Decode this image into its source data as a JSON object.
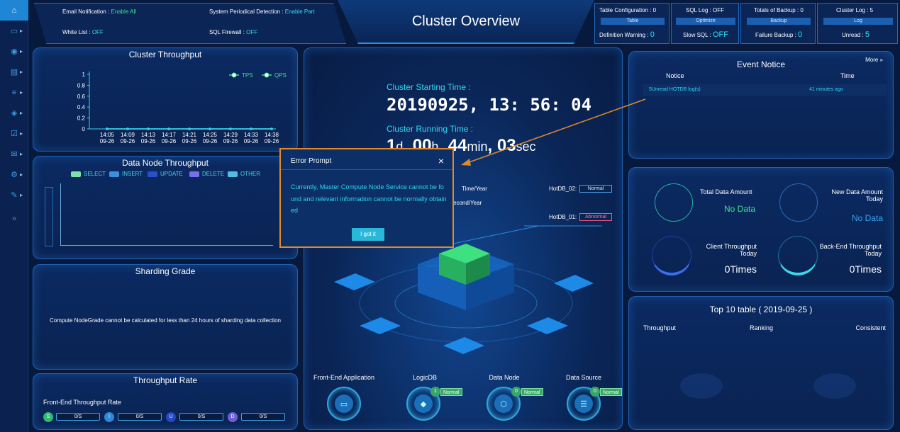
{
  "sidebar": {
    "items": [
      {
        "icon": "home-icon",
        "glyph": "⌂"
      },
      {
        "icon": "monitor-icon",
        "glyph": "▭"
      },
      {
        "icon": "eye-icon",
        "glyph": "◉"
      },
      {
        "icon": "chart-icon",
        "glyph": "▤"
      },
      {
        "icon": "database-icon",
        "glyph": "≡"
      },
      {
        "icon": "shield-icon",
        "glyph": "◈"
      },
      {
        "icon": "checklist-icon",
        "glyph": "☑"
      },
      {
        "icon": "mail-icon",
        "glyph": "✉"
      },
      {
        "icon": "gear-icon",
        "glyph": "⚙"
      },
      {
        "icon": "wrench-icon",
        "glyph": "✎"
      },
      {
        "icon": "expand-icon",
        "glyph": "»"
      }
    ]
  },
  "header": {
    "title": "Cluster Overview",
    "email_notification_label": "Email Notification :",
    "email_notification_value": "Enable All",
    "white_list_label": "White List :",
    "white_list_value": "OFF",
    "periodical_label": "System Periodical Detection :",
    "periodical_value": "Enable Part",
    "sql_firewall_label": "SQL Firewall :",
    "sql_firewall_value": "OFF",
    "boxes": [
      {
        "line1": "Table Configuration :",
        "v1": "0",
        "btn": "Table",
        "line2": "Definition Warning :",
        "v2": "0"
      },
      {
        "line1": "SQL Log :",
        "v1": "OFF",
        "btn": "Optimize",
        "line2": "Slow SQL :",
        "v2": "OFF"
      },
      {
        "line1": "Totals of Backup :",
        "v1": "0",
        "btn": "Backup",
        "line2": "Failure Backup :",
        "v2": "0"
      },
      {
        "line1": "Cluster Log :",
        "v1": "5",
        "btn": "Log",
        "line2": "Unread :",
        "v2": "5"
      }
    ]
  },
  "throughput": {
    "title": "Cluster Throughput",
    "legend_tps": "TPS",
    "legend_qps": "QPS"
  },
  "chart_data": {
    "type": "line",
    "title": "Cluster Throughput",
    "categories": [
      "14:05\n09-26",
      "14:09\n09-26",
      "14:13\n09-26",
      "14:17\n09-26",
      "14:21\n09-26",
      "14:25\n09-26",
      "14:29\n09-26",
      "14:33\n09-26",
      "14:38\n09-26"
    ],
    "x_labels_time": [
      "14:05",
      "14:09",
      "14:13",
      "14:17",
      "14:21",
      "14:25",
      "14:29",
      "14:33",
      "14:38"
    ],
    "x_labels_date": [
      "09-26",
      "09-26",
      "09-26",
      "09-26",
      "09-26",
      "09-26",
      "09-26",
      "09-26",
      "09-26"
    ],
    "series": [
      {
        "name": "TPS",
        "values": [
          0,
          0,
          0,
          0,
          0,
          0,
          0,
          0,
          0
        ]
      },
      {
        "name": "QPS",
        "values": [
          0,
          0,
          0,
          0,
          0,
          0,
          0,
          0,
          0
        ]
      }
    ],
    "y_ticks": [
      "1",
      "0.8",
      "0.6",
      "0.4",
      "0.2",
      "0"
    ],
    "ylim": [
      0,
      1
    ],
    "legend": "top-right",
    "colors": {
      "line": "#36d4e8",
      "axis": "#36d4e8"
    }
  },
  "data_node": {
    "title": "Data Node Throughput",
    "legend": [
      {
        "label": "SELECT",
        "color": "#7be3a8"
      },
      {
        "label": "INSERT",
        "color": "#3a8fe0"
      },
      {
        "label": "UPDATE",
        "color": "#2850c8"
      },
      {
        "label": "DELETE",
        "color": "#7b6ee8"
      },
      {
        "label": "OTHER",
        "color": "#4fc0e0"
      }
    ]
  },
  "sharding": {
    "title": "Sharding Grade",
    "message": "Compute NodeGrade cannot be calculated for less than 24 hours of sharding data collection"
  },
  "rate": {
    "title": "Throughput Rate",
    "subtitle": "Front-End Throughput Rate",
    "items": [
      {
        "letter": "S",
        "value": "0/S",
        "color": "#2eb872"
      },
      {
        "letter": "I",
        "value": "0/S",
        "color": "#2f88d8"
      },
      {
        "letter": "U",
        "value": "0/S",
        "color": "#2648c0"
      },
      {
        "letter": "D",
        "value": "0/S",
        "color": "#6e5ed8"
      }
    ]
  },
  "center": {
    "start_label": "Cluster Starting Time :",
    "start_date": "20190925",
    "start_h": "13",
    "start_m": "56",
    "start_s": "04",
    "running_label": "Cluster Running Time :",
    "run_d": "1",
    "run_d_unit": "d",
    "run_h": "00",
    "run_h_unit": "h",
    "run_min": "44",
    "run_min_unit": "min",
    "run_sec": "03",
    "run_sec_unit": "sec",
    "time_year": "Time/Year",
    "second_year": "econd/Year",
    "hotdb02_label": "HotDB_02:",
    "hotdb02_status": "Normal",
    "hotdb01_label": "HotDB_01:",
    "hotdb01_status": "Abnormal",
    "nodes": [
      {
        "label": "Front-End Application",
        "icon": "server-icon",
        "badge": null
      },
      {
        "label": "LogicDB",
        "icon": "cube-icon",
        "count": "1",
        "badge": "Normal"
      },
      {
        "label": "Data Node",
        "icon": "node-icon",
        "count": "0",
        "badge": "Normal"
      },
      {
        "label": "Data Source",
        "icon": "stack-icon",
        "count": "0",
        "badge": "Normal"
      }
    ]
  },
  "events": {
    "title": "Event Notice",
    "more": "More",
    "col_notice": "Notice",
    "col_time": "Time",
    "rows": [
      {
        "notice": "5Unread HOTDB log(s)",
        "time": "41 minutes ago"
      }
    ]
  },
  "data_amount": {
    "total_label": "Total Data Amount",
    "total_value": "No Data",
    "new_label": "New Data Amount Today",
    "new_value": "No Data",
    "client_label": "Client Throughput Today",
    "client_value": "0Times",
    "backend_label": "Back-End Throughput Today",
    "backend_value": "0Times"
  },
  "top10": {
    "title": "Top 10 table ( 2019-09-25 )",
    "col1": "Throughput",
    "col2": "Ranking",
    "col3": "Consistent"
  },
  "modal": {
    "title": "Error Prompt",
    "close": "×",
    "message": "Currently, Master Compute Node Service cannot be found and relevant information cannot be normally obtained",
    "button": "I got it"
  }
}
